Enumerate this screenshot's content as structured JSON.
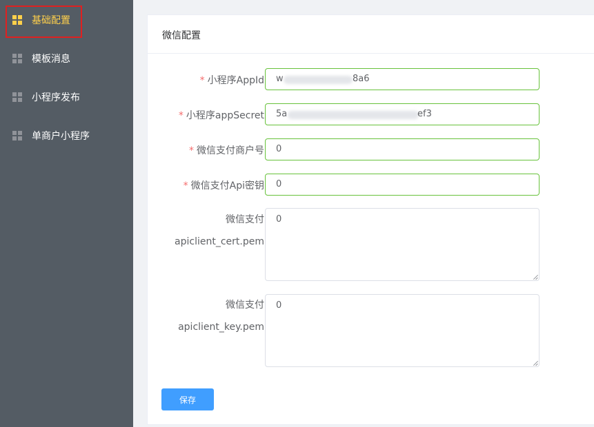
{
  "sidebar": {
    "items": [
      {
        "label": "基础配置",
        "icon": "grid-icon",
        "active": true
      },
      {
        "label": "模板消息",
        "icon": "grid-icon",
        "active": false
      },
      {
        "label": "小程序发布",
        "icon": "grid-icon",
        "active": false
      },
      {
        "label": "单商户小程序",
        "icon": "grid-icon",
        "active": false
      }
    ]
  },
  "card": {
    "title": "微信配置",
    "required_mark": "*",
    "fields": [
      {
        "label": "小程序AppId",
        "value_start": "w",
        "value_end": "8a6",
        "required": true
      },
      {
        "label": "小程序appSecret",
        "value_start": "5a",
        "value_end": "ef3",
        "required": true
      },
      {
        "label": "微信支付商户号",
        "value": "0",
        "required": true
      },
      {
        "label": "微信支付Api密钥",
        "value": "0",
        "required": true
      }
    ],
    "textareas": [
      {
        "label_line1": "微信支付",
        "label_line2": "apiclient_cert.pem",
        "value": "0"
      },
      {
        "label_line1": "微信支付",
        "label_line2": "apiclient_key.pem",
        "value": "0"
      }
    ],
    "save_label": "保存"
  },
  "colors": {
    "sidebar_bg": "#545c64",
    "active_text": "#ffd04b",
    "valid_border": "#67c23a",
    "primary": "#409eff",
    "required": "#f56c6c",
    "highlight_box": "#e02020"
  }
}
